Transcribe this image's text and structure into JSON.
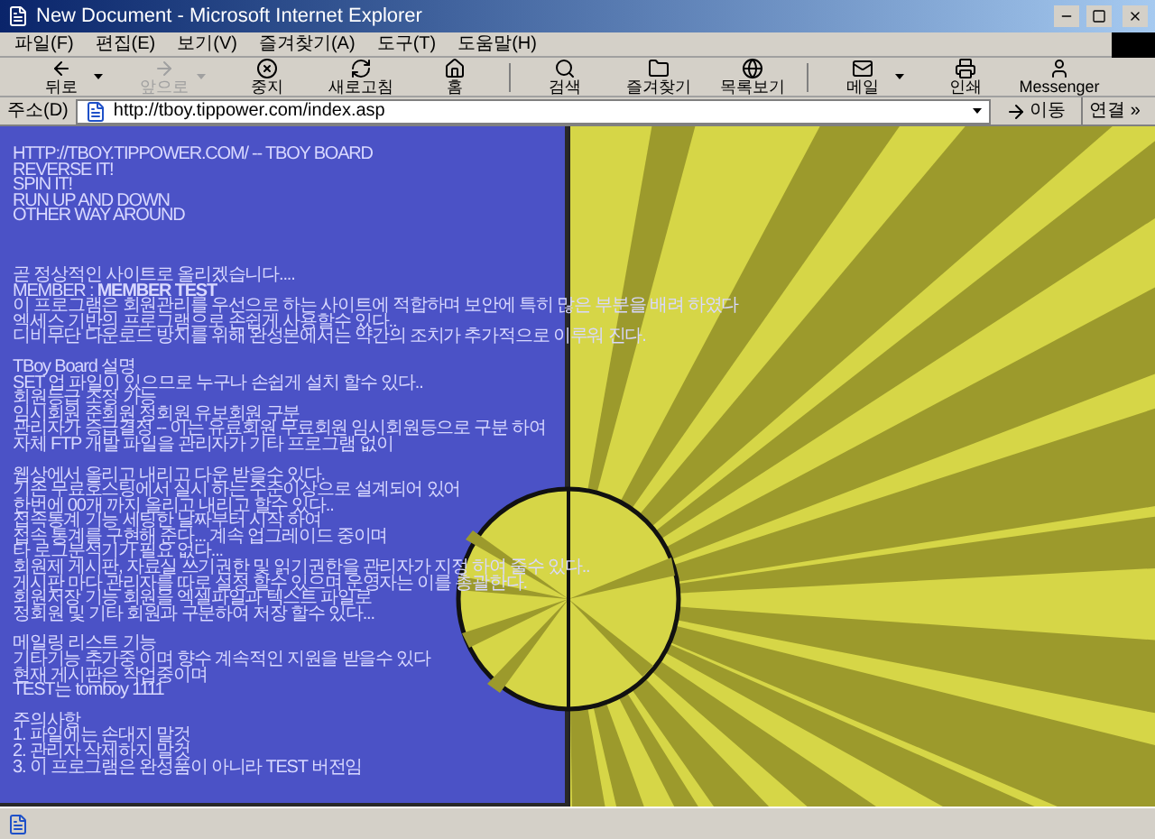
{
  "window": {
    "title": "New Document - Microsoft Internet Explorer"
  },
  "menu": [
    "파일(F)",
    "편집(E)",
    "보기(V)",
    "즐겨찾기(A)",
    "도구(T)",
    "도움말(H)"
  ],
  "toolbar": [
    {
      "kind": "back",
      "label": "뒤로",
      "disabled": false,
      "dropdown": true
    },
    {
      "kind": "forward",
      "label": "앞으로",
      "disabled": true,
      "dropdown": true
    },
    {
      "kind": "stop",
      "label": "중지",
      "disabled": false,
      "dropdown": false
    },
    {
      "kind": "refresh",
      "label": "새로고침",
      "disabled": false,
      "dropdown": false
    },
    {
      "kind": "home",
      "label": "홈",
      "disabled": false,
      "dropdown": false
    },
    {
      "kind": "search",
      "label": "검색",
      "disabled": false,
      "dropdown": false
    },
    {
      "kind": "favorites",
      "label": "즐겨찾기",
      "disabled": false,
      "dropdown": false
    },
    {
      "kind": "history",
      "label": "목록보기",
      "disabled": false,
      "dropdown": false
    },
    {
      "kind": "mail",
      "label": "메일",
      "disabled": false,
      "dropdown": true
    },
    {
      "kind": "print",
      "label": "인쇄",
      "disabled": false,
      "dropdown": false
    },
    {
      "kind": "messenger",
      "label": "Messenger",
      "disabled": false,
      "dropdown": false
    }
  ],
  "address": {
    "label": "주소(D)",
    "url": "http://tboy.tippower.com/index.asp",
    "go": "이동",
    "links": "연결 »"
  },
  "page": {
    "paragraphs": [
      [
        "HTTP://TBOY.TIPPOWER.COM/ -- TBOY BOARD",
        "REVERSE IT!",
        "SPIN IT!",
        "RUN UP AND DOWN",
        "OTHER WAY AROUND"
      ],
      [
        "곧 정상적인 사이트로 올리겠습니다....",
        "MEMBER : **MEMBER TEST**",
        "이 프로그램은 회원관리를 우선으로 하는 사이트에 적합하며 보안에 특히 많은 부분을 배려 하였다",
        "엑세스 기반의 프로그램으로 손쉽게 사용할수 있다..",
        "디비무단 다운로드 방지를 위해 완성본에서는 약간의 조치가 추가적으로 이루워 진다."
      ],
      [
        "TBoy Board 설명",
        "SET 업 파일이 있으므로 누구나 손쉽게 설치 할수 있다..",
        "회원등급 조정 가능",
        "임시회원 준회원 정회원 유보회원 구분",
        "관리자가 승급결정 -- 이는 유료회원 무료회원 임시회원등으로 구분 하여",
        "자체 FTP 개발 파일을 관리자가 기타 프로그램 없이"
      ],
      [
        "웹상에서 올리고 내리고 다운 받을수 있다.",
        "기존 무료호스팅에서 실시 하는 수준이상으로 설계되어 있어",
        "한번에 00개 까지 올리고 내리고 할수 있다..",
        "접속통계 기능 세팅한 날짜부터 시작 하여",
        "접속 통계를 구현해 준다... 계속 업그레이드 중이며",
        "타 로그분석기가 필요 없다...",
        "회원제 게시판, 자료실 쓰기권한 및 읽기권한을 관리자가 지정 하여 줄수 있다..",
        "게시판 마다 관리자를 따로 설정 할수 있으며 운영자는 이를 총괄한다.",
        "회원저장 기능 회원을 엑셀파일과 텍스트 파일로",
        "정회원 및 기타 회원과 구분하여 저장 할수 있다..."
      ],
      [
        "메일링 리스트 기능",
        "기타기능 추가중 이며 향수 계속적인 지원을 받을수 있다",
        "현재 게시판은 작업중이며",
        "TEST는 tomboy 1111"
      ],
      [
        "주의사항",
        "1. 파일에는 손대지 말것",
        "2. 관리자 삭제하지 말것",
        "3. 이 프로그램은 완성품이 아니라 TEST 버전임"
      ]
    ]
  }
}
